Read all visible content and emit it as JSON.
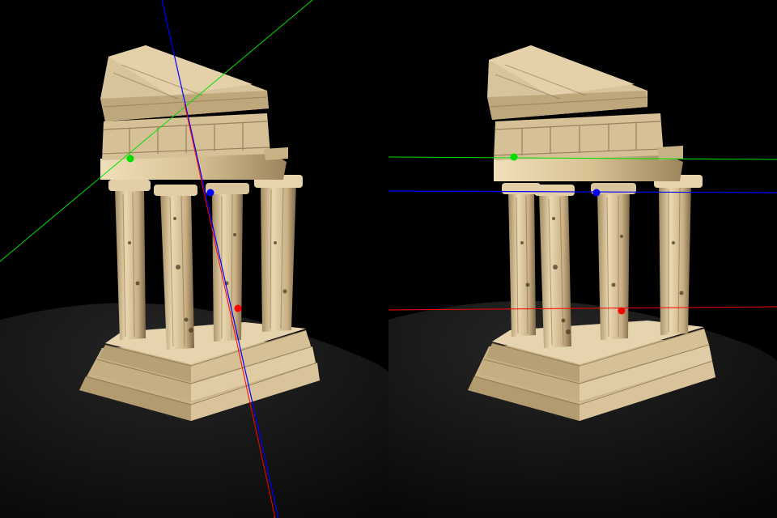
{
  "views": [
    {
      "label": "",
      "pose": "rotated"
    },
    {
      "label": "",
      "pose": "rectified"
    }
  ],
  "correspondences": [
    {
      "color": "#00e000"
    },
    {
      "color": "#0000ff"
    },
    {
      "color": "#ff0000"
    }
  ],
  "colors": {
    "background": "#000000",
    "cloth": "#161616",
    "stone_light": "#e3cfa6",
    "stone_mid": "#cbb388",
    "stone_dark": "#8a7350",
    "stone_shadow": "#4a3a24"
  }
}
